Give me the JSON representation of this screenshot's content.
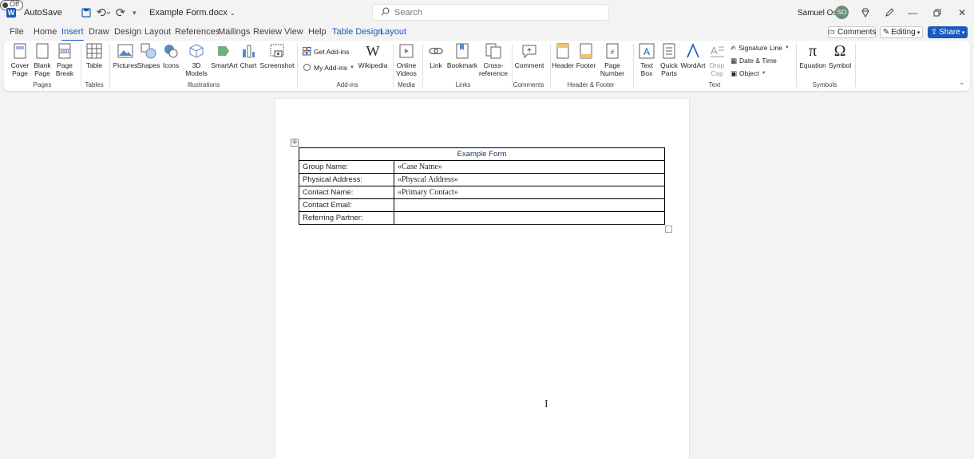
{
  "titlebar": {
    "autosave_label": "AutoSave",
    "autosave_state": "Off",
    "doc_title": "Example Form.docx",
    "search_placeholder": "Search",
    "user_name": "Samuel Osei",
    "user_initials": "SO"
  },
  "tabs": [
    "File",
    "Home",
    "Insert",
    "Draw",
    "Design",
    "Layout",
    "References",
    "Mailings",
    "Review",
    "View",
    "Help",
    "Table Design",
    "Layout"
  ],
  "active_tab": "Insert",
  "actions": {
    "comments": "Comments",
    "editing": "Editing",
    "share": "Share"
  },
  "ribbon": {
    "pages": {
      "label": "Pages",
      "cover_page": "Cover Page",
      "blank_page": "Blank Page",
      "page_break": "Page Break"
    },
    "tables": {
      "label": "Tables",
      "table": "Table"
    },
    "illustrations": {
      "label": "Illustrations",
      "pictures": "Pictures",
      "shapes": "Shapes",
      "icons": "Icons",
      "models_3d": "3D Models",
      "smartart": "SmartArt",
      "chart": "Chart",
      "screenshot": "Screenshot"
    },
    "addins": {
      "label": "Add-ins",
      "get_addins": "Get Add-ins",
      "my_addins": "My Add-ins",
      "wikipedia": "Wikipedia"
    },
    "media": {
      "label": "Media",
      "online_videos": "Online Videos"
    },
    "links": {
      "label": "Links",
      "link": "Link",
      "bookmark": "Bookmark",
      "cross_reference": "Cross-reference"
    },
    "comments": {
      "label": "Comments",
      "comment": "Comment"
    },
    "header_footer": {
      "label": "Header & Footer",
      "header": "Header",
      "footer": "Footer",
      "page_number": "Page Number"
    },
    "text": {
      "label": "Text",
      "text_box": "Text Box",
      "quick_parts": "Quick Parts",
      "wordart": "WordArt",
      "drop_cap": "Drop Cap",
      "signature_line": "Signature Line",
      "date_time": "Date & Time",
      "object": "Object"
    },
    "symbols": {
      "label": "Symbols",
      "equation": "Equation",
      "symbol": "Symbol"
    }
  },
  "document": {
    "table_title": "Example Form",
    "rows": [
      {
        "label": "Group Name:",
        "value": "«Case Name»"
      },
      {
        "label": "Physical Address:",
        "value": "«Physcal Address»"
      },
      {
        "label": "Contact Name:",
        "value": "«Primary Contact»"
      },
      {
        "label": "Contact Email:",
        "value": ""
      },
      {
        "label": "Referring Partner:",
        "value": ""
      }
    ]
  },
  "colors": {
    "accent": "#185abd",
    "table_header_text": "#1f3864"
  }
}
